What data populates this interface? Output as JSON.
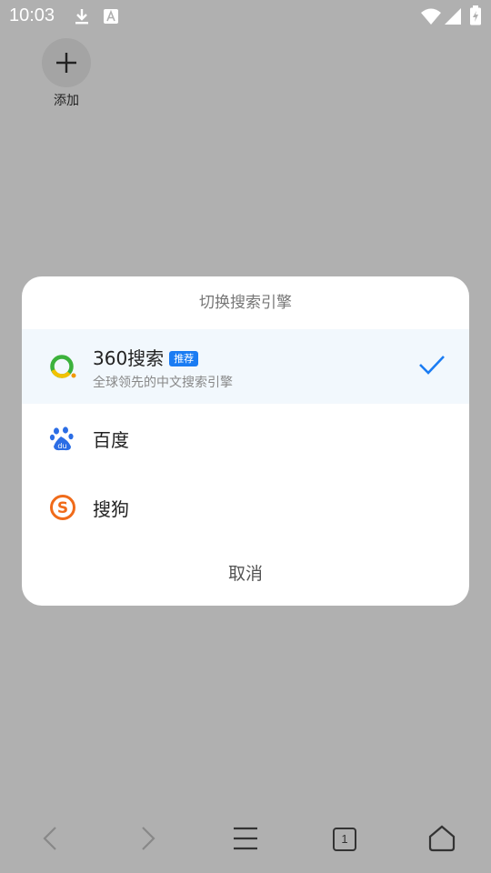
{
  "status_bar": {
    "time": "10:03"
  },
  "shortcut": {
    "add_label": "添加"
  },
  "dialog": {
    "title": "切换搜索引擎",
    "engines": [
      {
        "name": "360搜索",
        "badge": "推荐",
        "description": "全球领先的中文搜索引擎",
        "selected": true
      },
      {
        "name": "百度",
        "selected": false
      },
      {
        "name": "搜狗",
        "selected": false
      }
    ],
    "cancel_label": "取消"
  },
  "bottom_nav": {
    "tab_count": "1"
  },
  "colors": {
    "accent": "#1a7cf3",
    "scrim": "#b0b0b0",
    "selected_row": "#f2f8fd"
  }
}
